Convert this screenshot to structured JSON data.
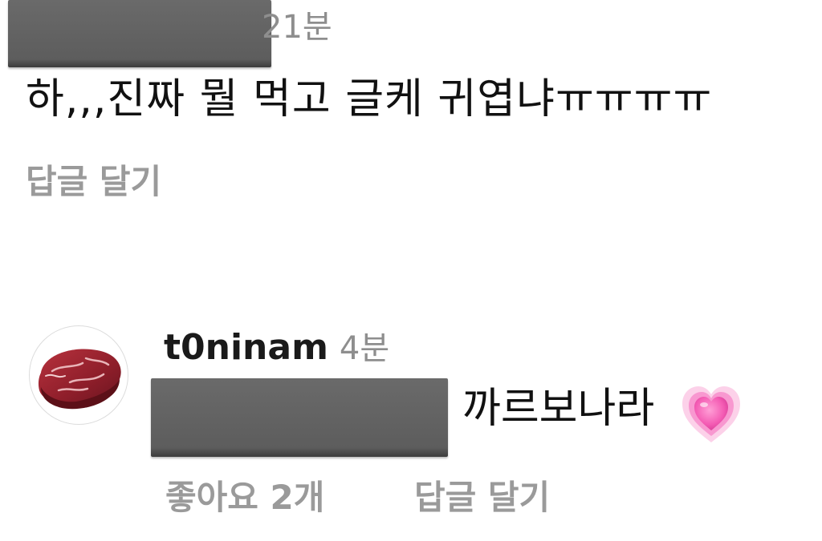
{
  "comment": {
    "timestamp": "21분",
    "text": "하,,,진짜 뭘 먹고 글케 귀엽냐ㅠㅠㅠㅠ",
    "reply_label": "답글 달기"
  },
  "reply": {
    "username": "t0ninam",
    "timestamp": "4분",
    "text": "까르보나라",
    "likes_label": "좋아요 2개",
    "reply_label": "답글 달기",
    "avatar_icon": "steak-icon",
    "emoji_icon": "growing-heart-icon"
  },
  "colors": {
    "text": "#111111",
    "muted": "#9a9a9a",
    "redaction": "#626262",
    "heart_pink": "#f45cb4"
  }
}
